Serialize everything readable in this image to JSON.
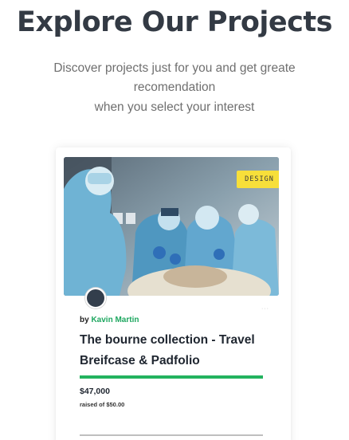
{
  "section": {
    "title": "Explore Our Projects",
    "subtitle_lines": [
      "Discover projects just for you and get greate",
      "recomendation",
      "when you select your interest"
    ]
  },
  "project_card": {
    "tag": "DESIGN",
    "author_prefix": "by",
    "author_name": "Kavin Martin",
    "title": "The bourne collection - Travel Breifcase & Padfolio",
    "amount_raised": "$47,000",
    "goal_text": "raised of $50.00",
    "progress_fraction": 1.0,
    "colors": {
      "accent_green": "#23b35f",
      "author_green": "#1ea760",
      "tag_yellow": "#f7df3a",
      "heading": "#333a44"
    }
  }
}
